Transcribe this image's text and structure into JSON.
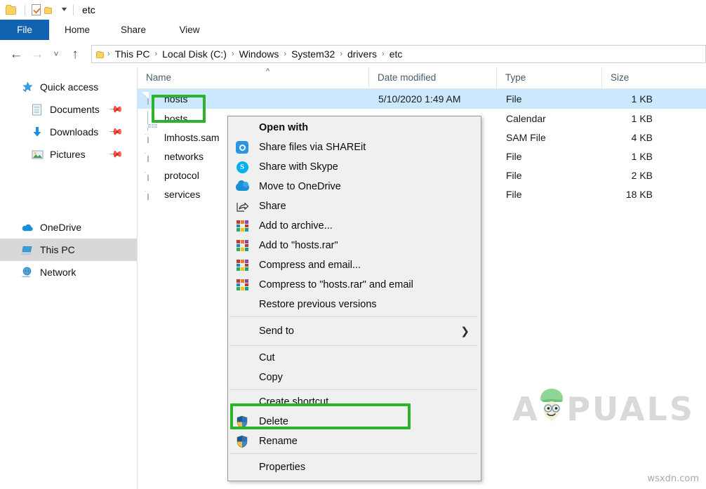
{
  "window": {
    "title": "etc",
    "quick_access_toolbar": [
      {
        "name": "folder-icon",
        "label": "Folder"
      },
      {
        "name": "properties-icon",
        "label": "Properties"
      },
      {
        "name": "new-folder-icon",
        "label": "New folder"
      },
      {
        "name": "customize-caret-icon",
        "label": "Customize Quick Access Toolbar"
      }
    ]
  },
  "ribbon": {
    "tabs": [
      {
        "label": "File",
        "active": true
      },
      {
        "label": "Home",
        "active": false
      },
      {
        "label": "Share",
        "active": false
      },
      {
        "label": "View",
        "active": false
      }
    ]
  },
  "nav": {
    "back": "←",
    "forward": "→",
    "recent": "˅",
    "up": "↑",
    "breadcrumbs": [
      "This PC",
      "Local Disk (C:)",
      "Windows",
      "System32",
      "drivers",
      "etc"
    ],
    "separator": "›"
  },
  "sidebar": {
    "items": [
      {
        "label": "Quick access",
        "icon": "star-icon",
        "pinned": false,
        "indent": false,
        "selected": false
      },
      {
        "label": "Documents",
        "icon": "documents-icon",
        "pinned": true,
        "indent": true,
        "selected": false
      },
      {
        "label": "Downloads",
        "icon": "downloads-icon",
        "pinned": true,
        "indent": true,
        "selected": false
      },
      {
        "label": "Pictures",
        "icon": "pictures-icon",
        "pinned": true,
        "indent": true,
        "selected": false
      },
      {
        "label": "OneDrive",
        "icon": "onedrive-icon",
        "pinned": false,
        "indent": false,
        "selected": false
      },
      {
        "label": "This PC",
        "icon": "thispc-icon",
        "pinned": false,
        "indent": false,
        "selected": true
      },
      {
        "label": "Network",
        "icon": "network-icon",
        "pinned": false,
        "indent": false,
        "selected": false
      }
    ]
  },
  "filelist": {
    "columns": [
      "Name",
      "Date modified",
      "Type",
      "Size"
    ],
    "sort_column": "Name",
    "sort_direction": "ascending",
    "rows": [
      {
        "name": "hosts",
        "icon": "document-icon",
        "date": "5/10/2020 1:49 AM",
        "type": "File",
        "size": "1 KB",
        "selected": true
      },
      {
        "name": "hosts",
        "icon": "calendar-icon",
        "date": "",
        "type": "Calendar",
        "size": "1 KB",
        "selected": false
      },
      {
        "name": "lmhosts.sam",
        "icon": "document-icon",
        "date": "",
        "type": "SAM File",
        "size": "4 KB",
        "selected": false
      },
      {
        "name": "networks",
        "icon": "document-icon",
        "date": "",
        "type": "File",
        "size": "1 KB",
        "selected": false
      },
      {
        "name": "protocol",
        "icon": "document-icon",
        "date": "",
        "type": "File",
        "size": "2 KB",
        "selected": false
      },
      {
        "name": "services",
        "icon": "document-icon",
        "date": "",
        "type": "File",
        "size": "18 KB",
        "selected": false
      }
    ]
  },
  "context_menu": {
    "items": [
      {
        "label": "Open with",
        "icon": "none",
        "bold": true,
        "type": "item"
      },
      {
        "label": "Share files via SHAREit",
        "icon": "shareit-icon",
        "bold": false,
        "type": "item"
      },
      {
        "label": "Share with Skype",
        "icon": "skype-icon",
        "bold": false,
        "type": "item"
      },
      {
        "label": "Move to OneDrive",
        "icon": "onedrive-icon",
        "bold": false,
        "type": "item"
      },
      {
        "label": "Share",
        "icon": "share-icon",
        "bold": false,
        "type": "item"
      },
      {
        "label": "Add to archive...",
        "icon": "winrar-icon",
        "bold": false,
        "type": "item"
      },
      {
        "label": "Add to \"hosts.rar\"",
        "icon": "winrar-icon",
        "bold": false,
        "type": "item"
      },
      {
        "label": "Compress and email...",
        "icon": "winrar-icon",
        "bold": false,
        "type": "item"
      },
      {
        "label": "Compress to \"hosts.rar\" and email",
        "icon": "winrar-icon",
        "bold": false,
        "type": "item"
      },
      {
        "label": "Restore previous versions",
        "icon": "none",
        "bold": false,
        "type": "item"
      },
      {
        "label": "",
        "icon": "none",
        "bold": false,
        "type": "separator"
      },
      {
        "label": "Send to",
        "icon": "none",
        "bold": false,
        "type": "submenu",
        "arrow": "›"
      },
      {
        "label": "",
        "icon": "none",
        "bold": false,
        "type": "separator"
      },
      {
        "label": "Cut",
        "icon": "none",
        "bold": false,
        "type": "item"
      },
      {
        "label": "Copy",
        "icon": "none",
        "bold": false,
        "type": "item"
      },
      {
        "label": "",
        "icon": "none",
        "bold": false,
        "type": "separator"
      },
      {
        "label": "Create shortcut",
        "icon": "none",
        "bold": false,
        "type": "item"
      },
      {
        "label": "Delete",
        "icon": "uac-shield-icon",
        "bold": false,
        "type": "item",
        "highlighted": true
      },
      {
        "label": "Rename",
        "icon": "uac-shield-icon",
        "bold": false,
        "type": "item"
      },
      {
        "label": "",
        "icon": "none",
        "bold": false,
        "type": "separator"
      },
      {
        "label": "Properties",
        "icon": "none",
        "bold": false,
        "type": "item"
      }
    ]
  },
  "annotations": {
    "highlight_color": "#2bb32b",
    "boxes": [
      {
        "target": "hosts-file-row",
        "name": "highlight-box-hosts-file"
      },
      {
        "target": "delete-menu-item",
        "name": "highlight-box-delete"
      }
    ]
  },
  "watermarks": {
    "brand": "PUALS",
    "brand_prefix": "A",
    "site": "wsxdn.com"
  },
  "colors": {
    "accent": "#1263af",
    "selection": "#cce8ff",
    "highlight": "#2bb32b",
    "menu_bg": "#f0f0f0"
  }
}
